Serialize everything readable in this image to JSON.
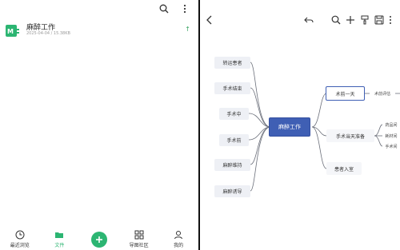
{
  "left": {
    "file": {
      "name": "麻醉工作",
      "meta": "2025-04-04 / 15.38KB",
      "pin": "↑"
    },
    "nav": {
      "recent": "最近浏览",
      "files": "文件",
      "community": "导图社区",
      "mine": "我的"
    }
  },
  "mindmap": {
    "root": "麻醉工作",
    "left_nodes": [
      "转运患者",
      "手术结束",
      "手术中",
      "手术前",
      "麻醉维持",
      "麻醉诱导"
    ],
    "right_nodes": [
      "术前一天",
      "手术当天准备",
      "患者入室"
    ],
    "sub_nodes": {
      "术前一天": [
        "术前评估"
      ],
      "手术当天准备": [
        "药品间",
        "耗材间",
        "手术间"
      ]
    }
  },
  "colors": {
    "brand_green": "#2cb572",
    "root_blue": "#3f5fb4",
    "divider": "#111111"
  }
}
